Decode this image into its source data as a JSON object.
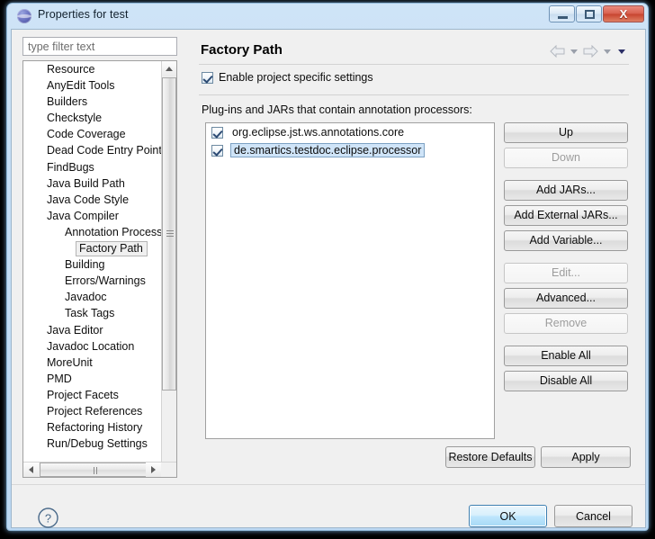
{
  "window": {
    "title": "Properties for test",
    "icon": "eclipse-globe-icon",
    "buttons": {
      "minimize": "minimize-icon",
      "maximize": "maximize-icon",
      "close": "X"
    }
  },
  "left": {
    "filter_placeholder": "type filter text",
    "filter_value": "",
    "tree": [
      {
        "label": "Resource",
        "level": 1,
        "selected": false
      },
      {
        "label": "AnyEdit Tools",
        "level": 1,
        "selected": false
      },
      {
        "label": "Builders",
        "level": 1,
        "selected": false
      },
      {
        "label": "Checkstyle",
        "level": 1,
        "selected": false
      },
      {
        "label": "Code Coverage",
        "level": 1,
        "selected": false
      },
      {
        "label": "Dead Code Entry Points",
        "level": 1,
        "selected": false
      },
      {
        "label": "FindBugs",
        "level": 1,
        "selected": false
      },
      {
        "label": "Java Build Path",
        "level": 1,
        "selected": false
      },
      {
        "label": "Java Code Style",
        "level": 1,
        "selected": false
      },
      {
        "label": "Java Compiler",
        "level": 1,
        "selected": false
      },
      {
        "label": "Annotation Processi",
        "level": 2,
        "selected": false
      },
      {
        "label": "Factory Path",
        "level": 3,
        "selected": true
      },
      {
        "label": "Building",
        "level": 2,
        "selected": false
      },
      {
        "label": "Errors/Warnings",
        "level": 2,
        "selected": false
      },
      {
        "label": "Javadoc",
        "level": 2,
        "selected": false
      },
      {
        "label": "Task Tags",
        "level": 2,
        "selected": false
      },
      {
        "label": "Java Editor",
        "level": 1,
        "selected": false
      },
      {
        "label": "Javadoc Location",
        "level": 1,
        "selected": false
      },
      {
        "label": "MoreUnit",
        "level": 1,
        "selected": false
      },
      {
        "label": "PMD",
        "level": 1,
        "selected": false
      },
      {
        "label": "Project Facets",
        "level": 1,
        "selected": false
      },
      {
        "label": "Project References",
        "level": 1,
        "selected": false
      },
      {
        "label": "Refactoring History",
        "level": 1,
        "selected": false
      },
      {
        "label": "Run/Debug Settings",
        "level": 1,
        "selected": false
      }
    ]
  },
  "right": {
    "title": "Factory Path",
    "nav": {
      "back": "back-arrow-icon",
      "back_menu": "chevron-down-icon",
      "forward": "forward-arrow-icon",
      "forward_menu": "chevron-down-icon",
      "view_menu": "chevron-down-icon"
    },
    "enable_checkbox": {
      "label": "Enable project specific settings",
      "checked": true
    },
    "section_label": "Plug-ins and JARs that contain annotation processors:",
    "list_items": [
      {
        "label": "org.eclipse.jst.ws.annotations.core",
        "checked": true,
        "selected": false
      },
      {
        "label": "de.smartics.testdoc.eclipse.processor",
        "checked": true,
        "selected": true
      }
    ],
    "side_buttons": [
      {
        "label": "Up",
        "enabled": true,
        "gap": false
      },
      {
        "label": "Down",
        "enabled": false,
        "gap": false
      },
      {
        "label": "Add JARs...",
        "enabled": true,
        "gap": true
      },
      {
        "label": "Add External JARs...",
        "enabled": true,
        "gap": false
      },
      {
        "label": "Add Variable...",
        "enabled": true,
        "gap": false
      },
      {
        "label": "Edit...",
        "enabled": false,
        "gap": true
      },
      {
        "label": "Advanced...",
        "enabled": true,
        "gap": false
      },
      {
        "label": "Remove",
        "enabled": false,
        "gap": false
      },
      {
        "label": "Enable All",
        "enabled": true,
        "gap": true
      },
      {
        "label": "Disable All",
        "enabled": true,
        "gap": false
      }
    ],
    "page_buttons": [
      {
        "label": "Restore Defaults"
      },
      {
        "label": "Apply"
      }
    ]
  },
  "bottom": {
    "help_icon": "help-question-icon",
    "ok_label": "OK",
    "cancel_label": "Cancel"
  },
  "colors": {
    "window_border": "#8fb8d9",
    "title_gradient_top": "#cfe4f7",
    "selection_blue": "#cfe4f8",
    "default_button_blue": "#bee6fd",
    "close_button_red": "#c7442f"
  }
}
